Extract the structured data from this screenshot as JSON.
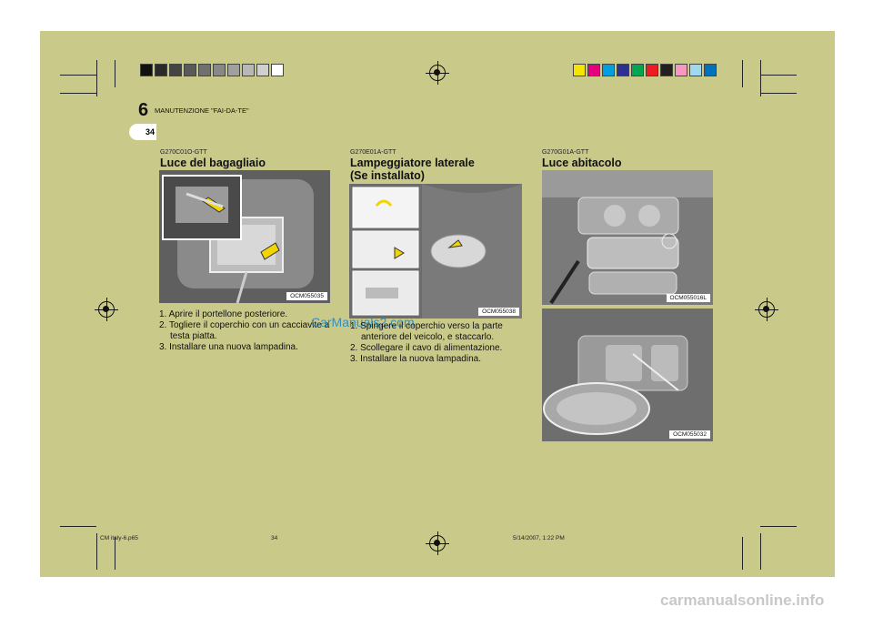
{
  "colors": {
    "page_bg": "#c9c98a",
    "gray_swatches": [
      "#111111",
      "#2a2a2a",
      "#444444",
      "#5a5a5a",
      "#707070",
      "#888888",
      "#a0a0a0",
      "#b8b8b8",
      "#d0d0d0",
      "#ffffff"
    ],
    "color_swatches": [
      "#f5e600",
      "#e6007e",
      "#00a0e0",
      "#2e3192",
      "#00a650",
      "#ed1c24",
      "#231f20",
      "#f49ac1",
      "#a0d8ef",
      "#0072bc"
    ]
  },
  "header": {
    "chapter_number": "6",
    "chapter_title": "MANUTENZIONE \"FAI-DA-TE\"",
    "page_number": "34"
  },
  "sections": [
    {
      "code": "G270C01O-GTT",
      "title": "Luce del bagagliaio",
      "image_label": "OCM055035",
      "steps": [
        "1. Aprire il portellone posteriore.",
        "2. Togliere il coperchio con un cacciavite a testa piatta.",
        "3. Installare una nuova lampadina."
      ]
    },
    {
      "code": "G270E01A-GTT",
      "title_line1": "Lampeggiatore laterale",
      "title_line2": "(Se installato)",
      "image_label": "OCM055038",
      "steps": [
        "1. Spingere il coperchio verso la parte anteriore del veicolo, e staccarlo.",
        "2. Scollegare il cavo di alimentazione.",
        "3. Installare la nuova lampadina."
      ]
    },
    {
      "code": "G270G01A-GTT",
      "title": "Luce abitacolo",
      "image_label_top": "OCM055016L",
      "image_label_bottom": "OCM055032"
    }
  ],
  "watermark": "CarManuals2.com",
  "footer": {
    "file": "CM italy-6.p65",
    "page": "34",
    "date": "5/14/2007, 1:22 PM"
  },
  "site_watermark": "carmanualsonline.info"
}
